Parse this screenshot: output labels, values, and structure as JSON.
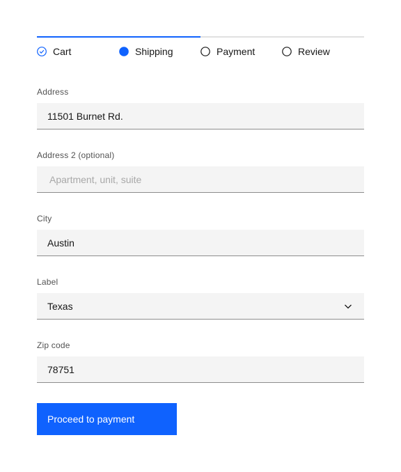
{
  "progress": {
    "completed_fraction": 0.5,
    "accent_color": "#0f62fe",
    "steps": [
      {
        "label": "Cart",
        "state": "complete",
        "icon": "checkmark-circle-icon"
      },
      {
        "label": "Shipping",
        "state": "current",
        "icon": "filled-circle-icon"
      },
      {
        "label": "Payment",
        "state": "incomplete",
        "icon": "empty-circle-icon"
      },
      {
        "label": "Review",
        "state": "incomplete",
        "icon": "empty-circle-icon"
      }
    ]
  },
  "form": {
    "address": {
      "label": "Address",
      "value": "11501 Burnet Rd."
    },
    "address2": {
      "label": "Address 2 (optional)",
      "value": "",
      "placeholder": "Apartment, unit, suite"
    },
    "city": {
      "label": "City",
      "value": "Austin"
    },
    "state": {
      "label": "Label",
      "value": "Texas",
      "icon": "chevron-down-icon"
    },
    "zip": {
      "label": "Zip code",
      "value": "78751"
    }
  },
  "submit": {
    "label": "Proceed to payment",
    "color": "#0f62fe"
  }
}
